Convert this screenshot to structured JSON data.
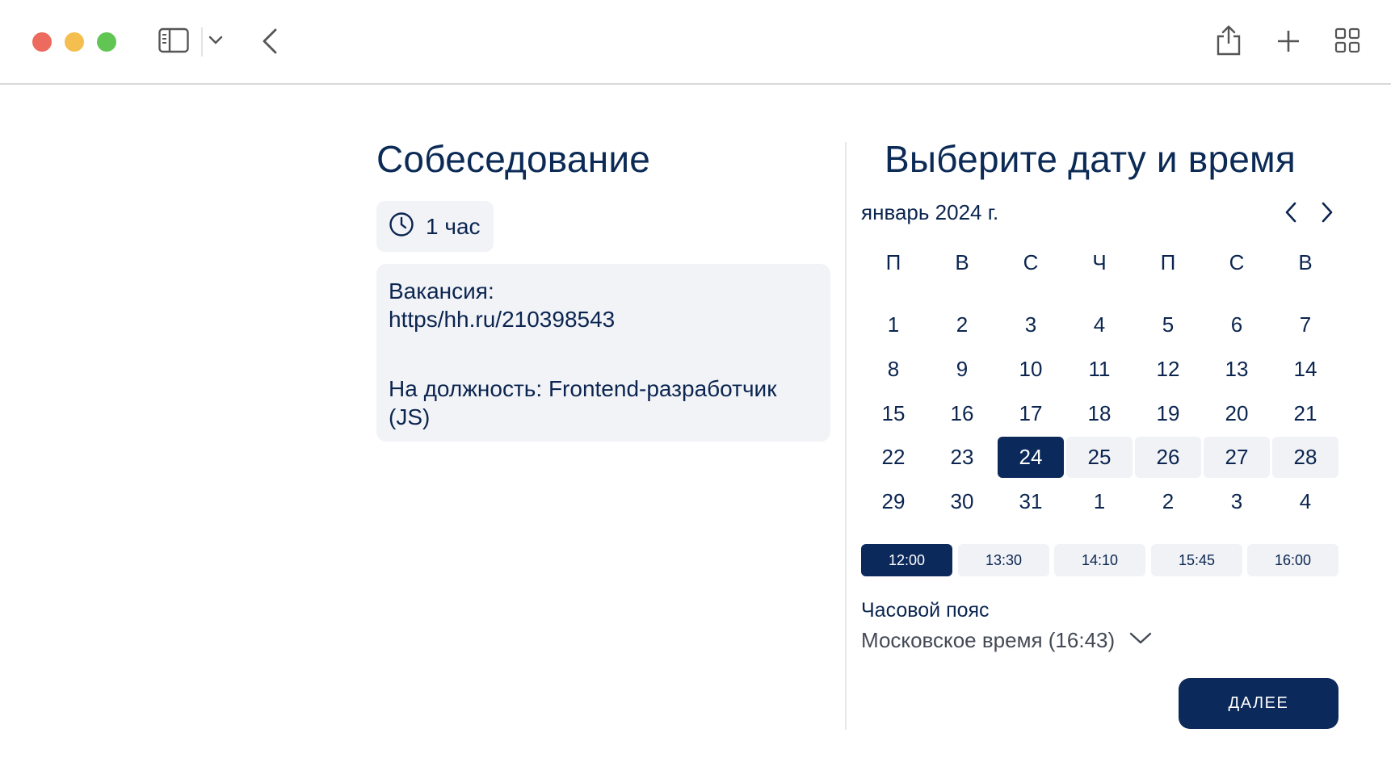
{
  "event": {
    "title": "Собеседование",
    "duration": "1 час",
    "description": {
      "vacancy_label": "Вакансия:",
      "vacancy_url": "https/hh.ru/210398543",
      "position_line1": "На должность: Frontend-разработчик",
      "position_line2": "(JS)"
    }
  },
  "picker": {
    "title": "Выберите дату и время",
    "month_label": "январь 2024 г.",
    "weekdays": [
      "П",
      "В",
      "С",
      "Ч",
      "П",
      "С",
      "В"
    ],
    "weeks": [
      [
        "1",
        "2",
        "3",
        "4",
        "5",
        "6",
        "7"
      ],
      [
        "8",
        "9",
        "10",
        "11",
        "12",
        "13",
        "14"
      ],
      [
        "15",
        "16",
        "17",
        "18",
        "19",
        "20",
        "21"
      ],
      [
        "22",
        "23",
        "24",
        "25",
        "26",
        "27",
        "28"
      ],
      [
        "29",
        "30",
        "31",
        "1",
        "2",
        "3",
        "4"
      ]
    ],
    "selected_day": "24",
    "available_days": [
      "25",
      "26",
      "27",
      "28"
    ],
    "time_slots": [
      "12:00",
      "13:30",
      "14:10",
      "15:45",
      "16:00"
    ],
    "selected_slot": "12:00"
  },
  "timezone": {
    "label": "Часовой пояс",
    "value": "Московское время (16:43)"
  },
  "actions": {
    "next_label": "ДАЛЕЕ"
  },
  "colors": {
    "accent": "#0b2a5b",
    "chip_bg": "#f2f3f7"
  }
}
